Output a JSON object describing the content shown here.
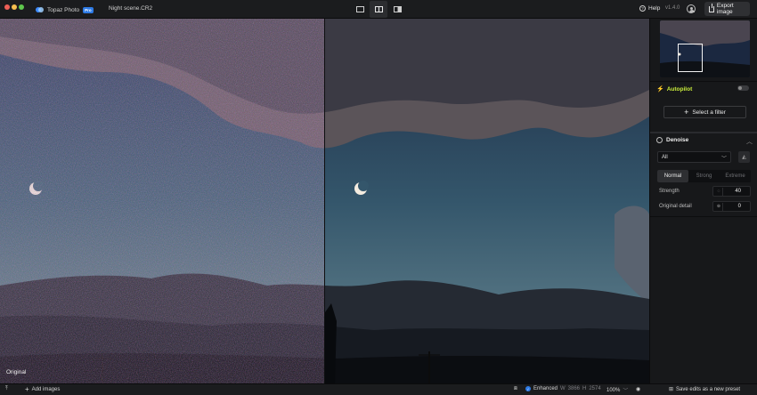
{
  "app": {
    "name": "Topaz Photo",
    "badge": "Pro",
    "file_name": "Night scene.CR2",
    "version": "v1.4.0"
  },
  "toolbar": {
    "view_modes": [
      "single-view-icon",
      "split-view-icon",
      "side-by-side-icon"
    ],
    "active_view": "split-view-icon",
    "help_label": "Help",
    "export_label": "Export image"
  },
  "canvas": {
    "left_label": "Original",
    "right_status_icon": "✓"
  },
  "sidebar": {
    "autopilot_label": "Autopilot",
    "autopilot_enabled": false,
    "select_filter_label": "Select a filter",
    "filter": {
      "name": "Denoise",
      "model_value": "All",
      "modes": [
        "Normal",
        "Strong",
        "Extreme"
      ],
      "active_mode": "Normal",
      "params": [
        {
          "label": "Strength",
          "value": "40"
        },
        {
          "label": "Original detail",
          "value": "0"
        }
      ]
    }
  },
  "bottombar": {
    "add_images_label": "Add images",
    "enhanced_label": "Enhanced",
    "width_prefix": "W",
    "width_value": "3866",
    "height_prefix": "H",
    "height_value": "2574",
    "zoom": "100%",
    "save_preset_label": "Save edits as a new preset"
  },
  "colors": {
    "accent_blue": "#2e7be6",
    "autopilot_green": "#c8ec3b",
    "background": "#111214",
    "sidebar": "#17181a"
  }
}
